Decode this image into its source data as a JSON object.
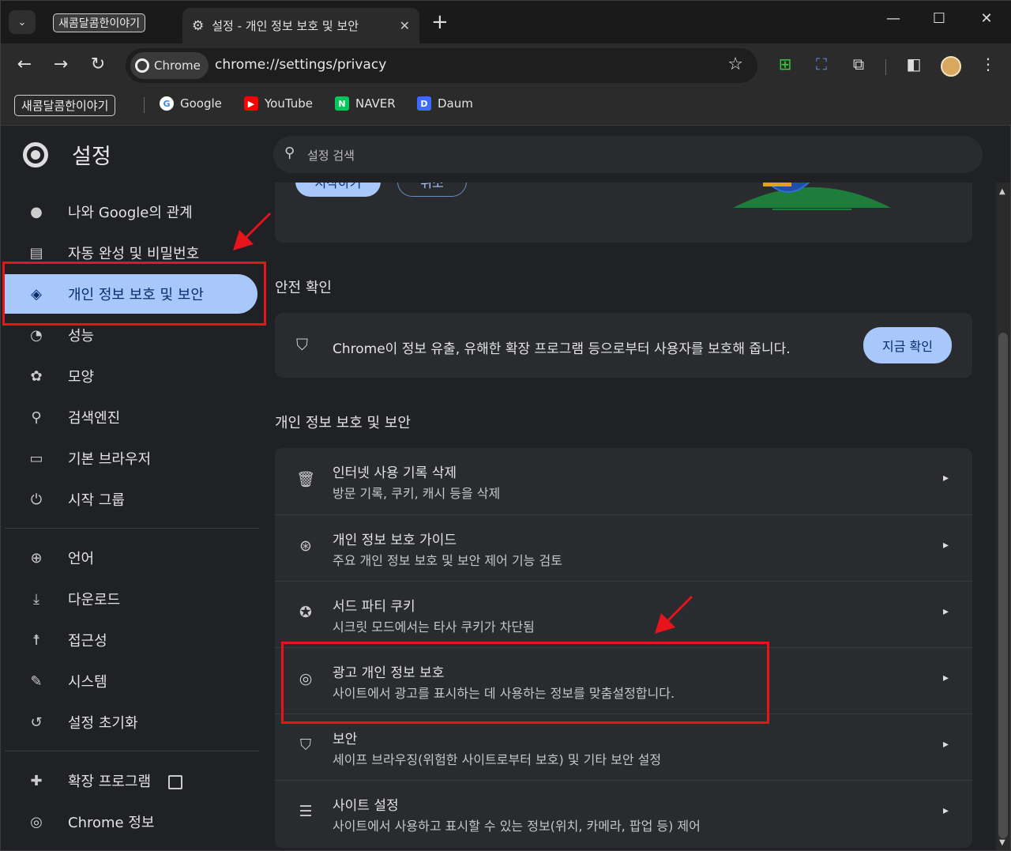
{
  "tabs": {
    "inactive_chip": "새콤달콤한이야기",
    "active_title": "설정 - 개인 정보 보호 및 보안",
    "close": "✕",
    "new_tab": "+"
  },
  "window_controls": {
    "minimize": "—",
    "maximize": "☐",
    "close": "✕"
  },
  "toolbar": {
    "back": "←",
    "forward": "→",
    "reload": "↻",
    "site_chip": "Chrome",
    "url": "chrome://settings/privacy",
    "star": "☆"
  },
  "bookmarks": {
    "folder": "새콤달콤한이야기",
    "items": [
      {
        "label": "Google",
        "icon_text": "G",
        "color": "#ffffff"
      },
      {
        "label": "YouTube",
        "icon_text": "▶",
        "color": "#ff0000"
      },
      {
        "label": "NAVER",
        "icon_text": "N",
        "color": "#03c75a"
      },
      {
        "label": "Daum",
        "icon_text": "D",
        "color": "#3d6bff"
      }
    ]
  },
  "settings": {
    "title": "설정",
    "search_placeholder": "설정 검색"
  },
  "sidebar": {
    "items": [
      {
        "label": "나와 Google의 관계",
        "icon": "👤"
      },
      {
        "label": "자동 완성 및 비밀번호",
        "icon": "📋"
      },
      {
        "label": "개인 정보 보호 및 보안",
        "icon": "🛡"
      },
      {
        "label": "성능",
        "icon": "◔"
      },
      {
        "label": "모양",
        "icon": "🎨"
      },
      {
        "label": "검색엔진",
        "icon": "🔍"
      },
      {
        "label": "기본 브라우저",
        "icon": "▭"
      },
      {
        "label": "시작 그룹",
        "icon": "⏻"
      },
      {
        "label": "언어",
        "icon": "🌐"
      },
      {
        "label": "다운로드",
        "icon": "⤓"
      },
      {
        "label": "접근성",
        "icon": "♿"
      },
      {
        "label": "시스템",
        "icon": "🔧"
      },
      {
        "label": "설정 초기화",
        "icon": "↺"
      },
      {
        "label": "확장 프로그램",
        "icon": "🧩"
      },
      {
        "label": "Chrome 정보",
        "icon": "◎"
      }
    ]
  },
  "main": {
    "promo": {
      "start_button": "시작하기",
      "cancel_button": "취소"
    },
    "safety_check": {
      "heading": "안전 확인",
      "text": "Chrome이 정보 유출, 유해한 확장 프로그램 등으로부터 사용자를 보호해 줍니다.",
      "button": "지금 확인"
    },
    "privacy": {
      "heading": "개인 정보 보호 및 보안",
      "rows": [
        {
          "title": "인터넷 사용 기록 삭제",
          "subtitle": "방문 기록, 쿠키, 캐시 등을 삭제",
          "icon": "🗑"
        },
        {
          "title": "개인 정보 보호 가이드",
          "subtitle": "주요 개인 정보 보호 및 보안 제어 기능 검토",
          "icon": "⊕"
        },
        {
          "title": "서드 파티 쿠키",
          "subtitle": "시크릿 모드에서는 타사 쿠키가 차단됨",
          "icon": "🍪"
        },
        {
          "title": "광고 개인 정보 보호",
          "subtitle": "사이트에서 광고를 표시하는 데 사용하는 정보를 맞춤설정합니다.",
          "icon": "◎"
        },
        {
          "title": "보안",
          "subtitle": "세이프 브라우징(위험한 사이트로부터 보호) 및 기타 보안 설정",
          "icon": "🛡"
        },
        {
          "title": "사이트 설정",
          "subtitle": "사이트에서 사용하고 표시할 수 있는 정보(위치, 카메라, 팝업 등) 제어",
          "icon": "☰"
        }
      ],
      "chevron": "▸"
    }
  }
}
